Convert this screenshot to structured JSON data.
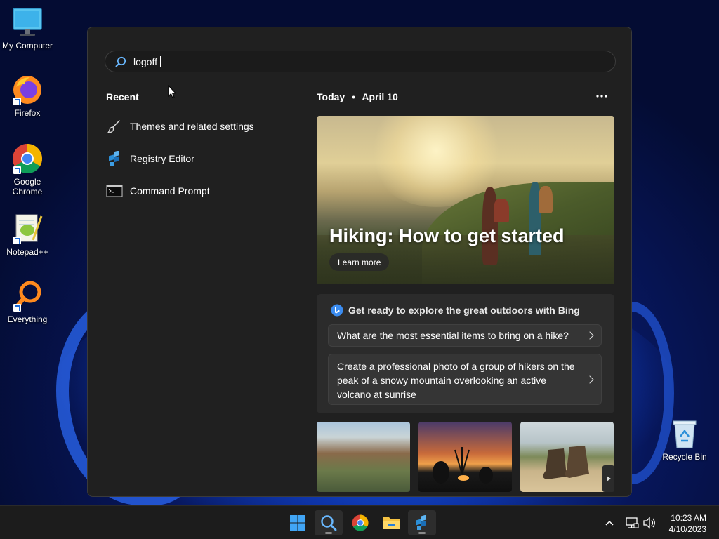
{
  "desktop": {
    "icons": [
      {
        "label": "My Computer",
        "icon": "monitor-icon"
      },
      {
        "label": "Firefox",
        "icon": "firefox-icon"
      },
      {
        "label": "Google Chrome",
        "icon": "chrome-icon"
      },
      {
        "label": "Notepad++",
        "icon": "notepadpp-icon"
      },
      {
        "label": "Everything",
        "icon": "everything-icon"
      },
      {
        "label": "Recycle Bin",
        "icon": "recycle-bin-icon"
      }
    ]
  },
  "search": {
    "value": "logoff"
  },
  "recent": {
    "title": "Recent",
    "items": [
      {
        "label": "Themes and related settings",
        "icon": "brush-icon"
      },
      {
        "label": "Registry Editor",
        "icon": "registry-icon"
      },
      {
        "label": "Command Prompt",
        "icon": "cmd-icon"
      }
    ]
  },
  "today": {
    "title": "Today",
    "separator": "•",
    "date": "April 10",
    "more_icon": "more-icon"
  },
  "hero": {
    "title": "Hiking: How to get started",
    "button": "Learn more"
  },
  "bing": {
    "heading": "Get ready to explore the great outdoors with Bing",
    "questions": [
      "What are the most essential items to bring on a hike?",
      "Create a professional photo of a group of hikers on the peak of a snowy mountain overlooking an active volcano at sunrise"
    ]
  },
  "taskbar": {
    "time": "10:23 AM",
    "date": "4/10/2023"
  },
  "colors": {
    "accent": "#0a84ff",
    "panel_bg": "#202020",
    "taskbar_bg": "#1c1c1c"
  }
}
